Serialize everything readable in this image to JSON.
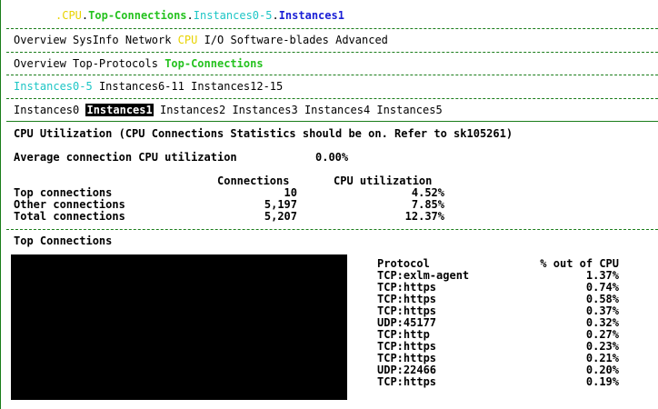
{
  "breadcrumb": {
    "prefix": ".",
    "cpu": "CPU",
    "dot1": ".",
    "top_connections": "Top-Connections",
    "dot2": ".",
    "instances_0_5": "Instances0-5",
    "dot3": ".",
    "instances1": "Instances1"
  },
  "menu_main": [
    "Overview",
    "SysInfo",
    "Network",
    "CPU",
    "I/O",
    "Software-blades",
    "Advanced"
  ],
  "menu_cpu": [
    "Overview",
    "Top-Protocols",
    "Top-Connections"
  ],
  "menu_instance_groups": [
    "Instances0-5",
    "Instances6-11",
    "Instances12-15"
  ],
  "menu_instances": [
    "Instances0",
    "Instances1",
    "Instances2",
    "Instances3",
    "Instances4",
    "Instances5"
  ],
  "section_title": "CPU Utilization (CPU Connections Statistics should be on. Refer to sk105261)",
  "avg_label": "Average connection CPU utilization",
  "avg_value": "0.00%",
  "summary": {
    "col_connections": "Connections",
    "col_cpu": "CPU utilization",
    "rows": [
      {
        "label": "Top connections",
        "connections": "10",
        "cpu": "4.52%"
      },
      {
        "label": "Other connections",
        "connections": "5,197",
        "cpu": "7.85%"
      },
      {
        "label": "Total connections",
        "connections": "5,207",
        "cpu": "12.37%"
      }
    ]
  },
  "top_connections_title": "Top Connections",
  "protocol_table": {
    "col_protocol": "Protocol",
    "col_cpu": "% out of CPU",
    "rows": [
      {
        "protocol": "TCP:exlm-agent",
        "cpu": "1.37%"
      },
      {
        "protocol": "TCP:https",
        "cpu": "0.74%"
      },
      {
        "protocol": "TCP:https",
        "cpu": "0.58%"
      },
      {
        "protocol": "TCP:https",
        "cpu": "0.37%"
      },
      {
        "protocol": "UDP:45177",
        "cpu": "0.32%"
      },
      {
        "protocol": "TCP:http",
        "cpu": "0.27%"
      },
      {
        "protocol": "TCP:https",
        "cpu": "0.23%"
      },
      {
        "protocol": "TCP:https",
        "cpu": "0.21%"
      },
      {
        "protocol": "UDP:22466",
        "cpu": "0.20%"
      },
      {
        "protocol": "TCP:https",
        "cpu": "0.19%"
      }
    ]
  },
  "colors": {
    "border": "#1a7d1a",
    "yellow": "#e8d300",
    "green": "#25c21f",
    "cyan": "#1ec6c6",
    "blue": "#1a1fd6"
  }
}
